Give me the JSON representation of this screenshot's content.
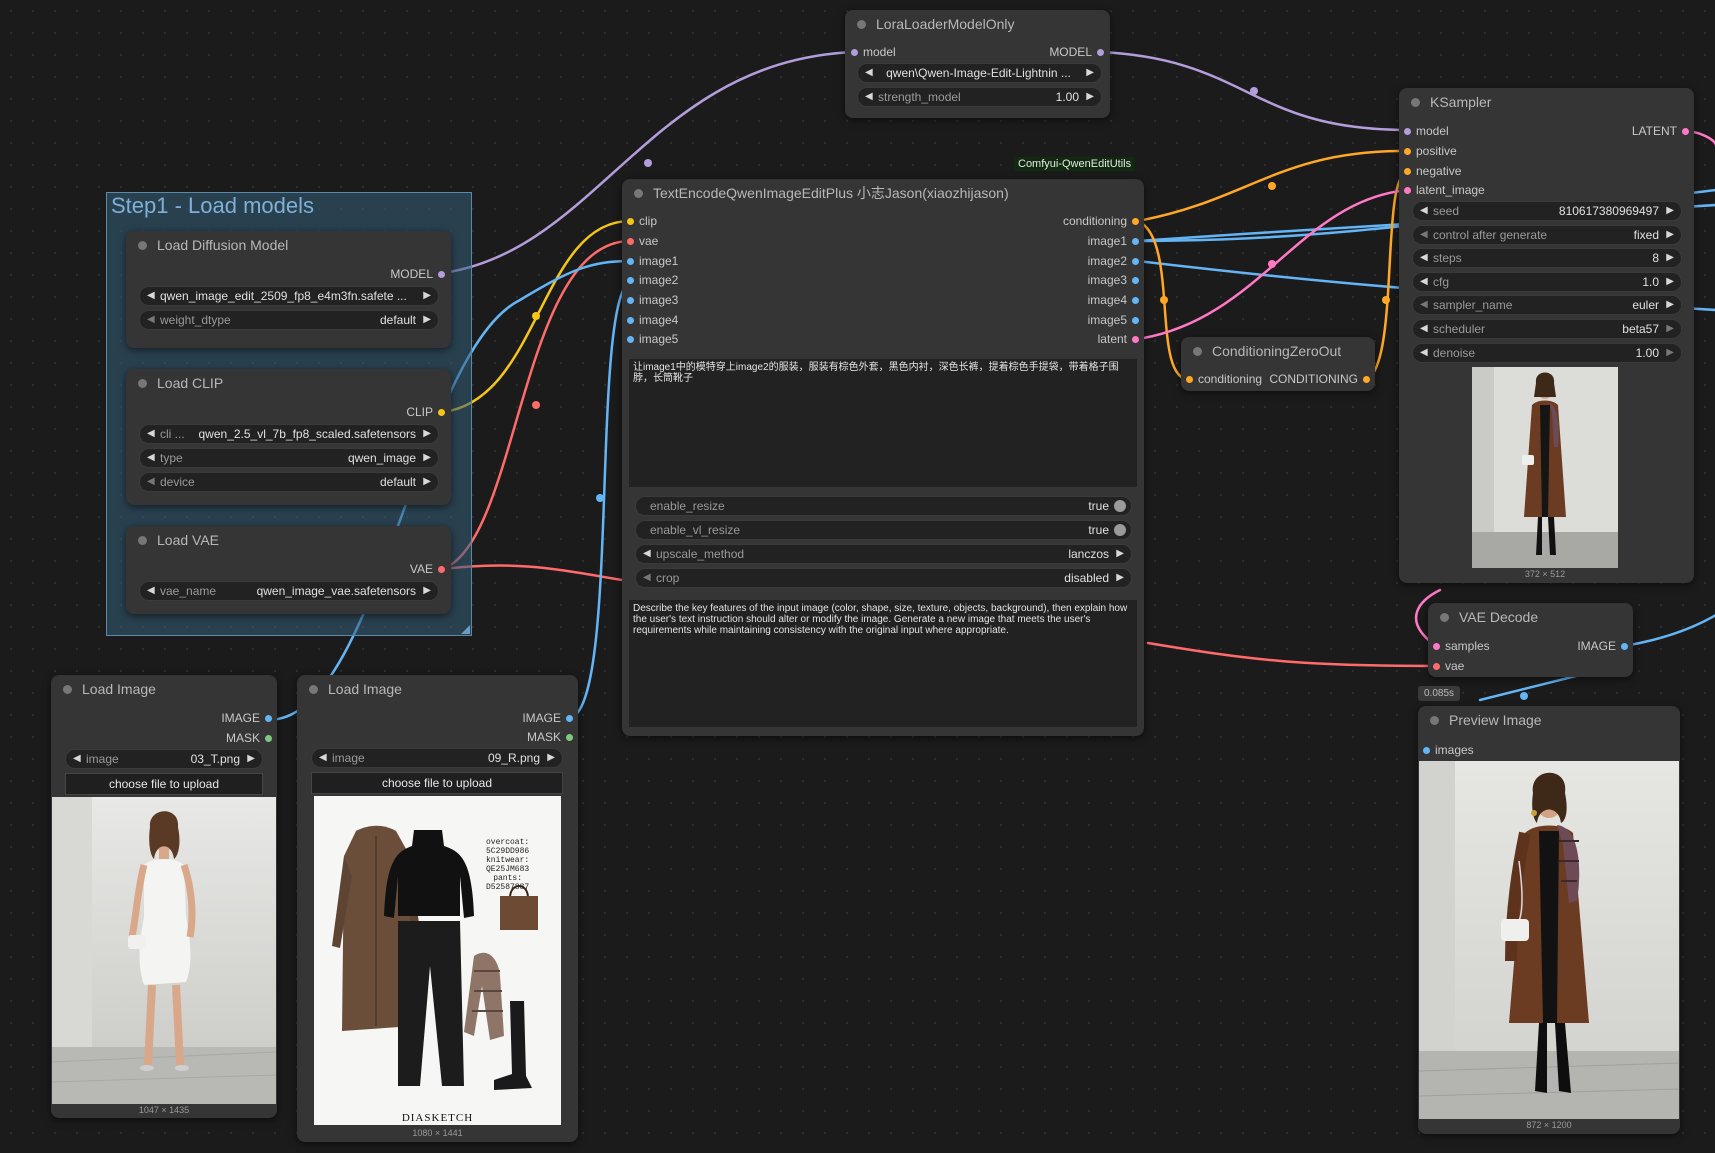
{
  "colors": {
    "clip": "#f5c518",
    "vae": "#ff6b6b",
    "image": "#64b5f6",
    "model": "#b39ddb",
    "conditioning": "#ffa726",
    "latent": "#ff79c6",
    "mask": "#81c784",
    "background": "#1b1b1b"
  },
  "group": {
    "title": "Step1 - Load models"
  },
  "lora": {
    "title": "LoraLoaderModelOnly",
    "in_model": "model",
    "out_model": "MODEL",
    "w1_value": "qwen\\Qwen-Image-Edit-Lightnin ...",
    "w2_label": "strength_model",
    "w2_value": "1.00"
  },
  "badge": "Comfyui-QwenEditUtils",
  "text_encode": {
    "title": "TextEncodeQwenImageEditPlus 小志Jason(xiaozhijason)",
    "inputs": [
      "clip",
      "vae",
      "image1",
      "image2",
      "image3",
      "image4",
      "image5"
    ],
    "outputs": [
      "conditioning",
      "image1",
      "image2",
      "image3",
      "image4",
      "image5",
      "latent"
    ],
    "prompt": "让image1中的模特穿上image2的服装，服装有棕色外套，黑色内衬，深色长裤，提着棕色手提袋，带着格子围脖，长筒靴子",
    "widgets": [
      {
        "label": "enable_resize",
        "value": "true"
      },
      {
        "label": "enable_vl_resize",
        "value": "true"
      },
      {
        "label": "upscale_method",
        "value": "lanczos"
      },
      {
        "label": "crop",
        "value": "disabled"
      }
    ],
    "system_prompt": "Describe the key features of the input image (color, shape, size, texture, objects, background), then explain how the user's text instruction should alter or modify the image. Generate a new image that meets the user's requirements while maintaining consistency with the original input where appropriate."
  },
  "load_diffusion": {
    "title": "Load Diffusion Model",
    "out": "MODEL",
    "w1_value": "qwen_image_edit_2509_fp8_e4m3fn.safete ...",
    "w2_label": "weight_dtype",
    "w2_value": "default"
  },
  "load_clip": {
    "title": "Load CLIP",
    "out": "CLIP",
    "w1_label": "cli ...",
    "w1_value": "qwen_2.5_vl_7b_fp8_scaled.safetensors",
    "w2_label": "type",
    "w2_value": "qwen_image",
    "w3_label": "device",
    "w3_value": "default"
  },
  "load_vae": {
    "title": "Load VAE",
    "out": "VAE",
    "w1_label": "vae_name",
    "w1_value": "qwen_image_vae.safetensors"
  },
  "load_image_1": {
    "title": "Load Image",
    "out_image": "IMAGE",
    "out_mask": "MASK",
    "w_label": "image",
    "w_value": "03_T.png",
    "upload": "choose file to upload",
    "dims": "1047 × 1435"
  },
  "load_image_2": {
    "title": "Load Image",
    "out_image": "IMAGE",
    "out_mask": "MASK",
    "w_label": "image",
    "w_value": "09_R.png",
    "upload": "choose file to upload",
    "dims": "1080 × 1441",
    "sheet_lines": [
      "overcoat:",
      "5C29DD986",
      "knitwear:",
      "QE25JM683",
      "pants:",
      "D52587887"
    ],
    "brand": "DIASKETCH"
  },
  "zero_out": {
    "title": "ConditioningZeroOut",
    "in": "conditioning",
    "out": "CONDITIONING"
  },
  "ksampler": {
    "title": "KSampler",
    "inputs": [
      "model",
      "positive",
      "negative",
      "latent_image"
    ],
    "out": "LATENT",
    "widgets": [
      {
        "label": "seed",
        "value": "810617380969497"
      },
      {
        "label": "control after generate",
        "value": "fixed"
      },
      {
        "label": "steps",
        "value": "8"
      },
      {
        "label": "cfg",
        "value": "1.0"
      },
      {
        "label": "sampler_name",
        "value": "euler"
      },
      {
        "label": "scheduler",
        "value": "beta57"
      },
      {
        "label": "denoise",
        "value": "1.00"
      }
    ],
    "dims": "372 × 512"
  },
  "vae_decode": {
    "title": "VAE Decode",
    "in_samples": "samples",
    "in_vae": "vae",
    "out": "IMAGE",
    "time": "0.085s"
  },
  "preview": {
    "title": "Preview Image",
    "in": "images",
    "dims": "872 × 1200"
  }
}
